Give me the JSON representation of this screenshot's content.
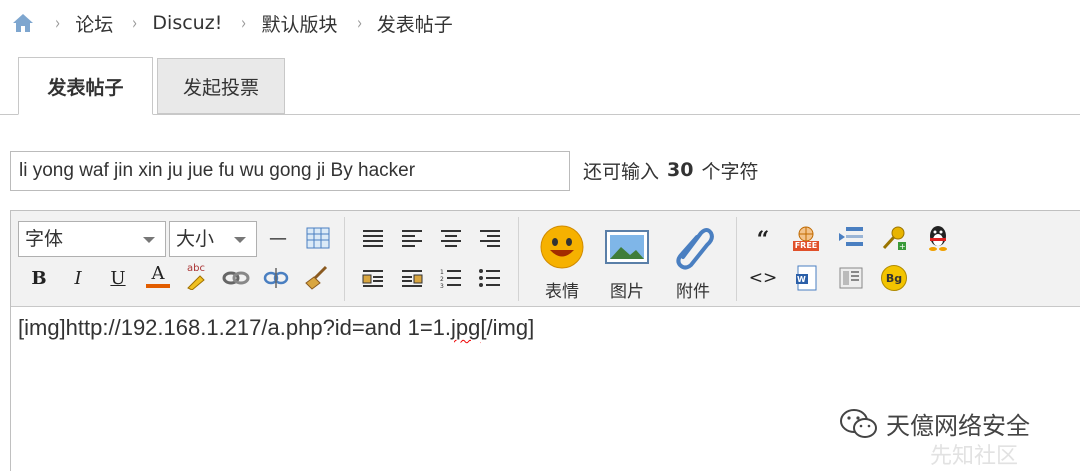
{
  "breadcrumb": {
    "items": [
      "论坛",
      "Discuz!",
      "默认版块",
      "发表帖子"
    ],
    "separator": "›"
  },
  "tabs": [
    {
      "label": "发表帖子",
      "active": true
    },
    {
      "label": "发起投票",
      "active": false
    }
  ],
  "subject": {
    "value": "li yong waf jin xin ju jue fu wu gong ji By hacker",
    "counter_prefix": "还可输入",
    "counter_value": "30",
    "counter_suffix": "个字符"
  },
  "toolbar": {
    "font_select": "字体",
    "size_select": "大小",
    "emoticon_label": "表情",
    "image_label": "图片",
    "attachment_label": "附件",
    "bold": "B",
    "italic": "I",
    "underline": "U",
    "font_color": "A",
    "quote": "“",
    "code": "<>",
    "hr": "—",
    "free_badge": "FREE",
    "bg_badge": "Bg",
    "abc_badge": "abc"
  },
  "editor": {
    "content_prefix": "[img]http://192.168.1.217/a.php?id=and 1=1.",
    "content_misspelled": "jpg",
    "content_suffix": "[/img]"
  },
  "watermark": {
    "text": "天億网络安全",
    "secondary": "先知社区"
  },
  "colors": {
    "accent_blue": "#4a7fc1",
    "tab_inactive_bg": "#e9e9e9",
    "toolbar_bg": "#f2f2f2",
    "spell_error": "#e00000"
  }
}
